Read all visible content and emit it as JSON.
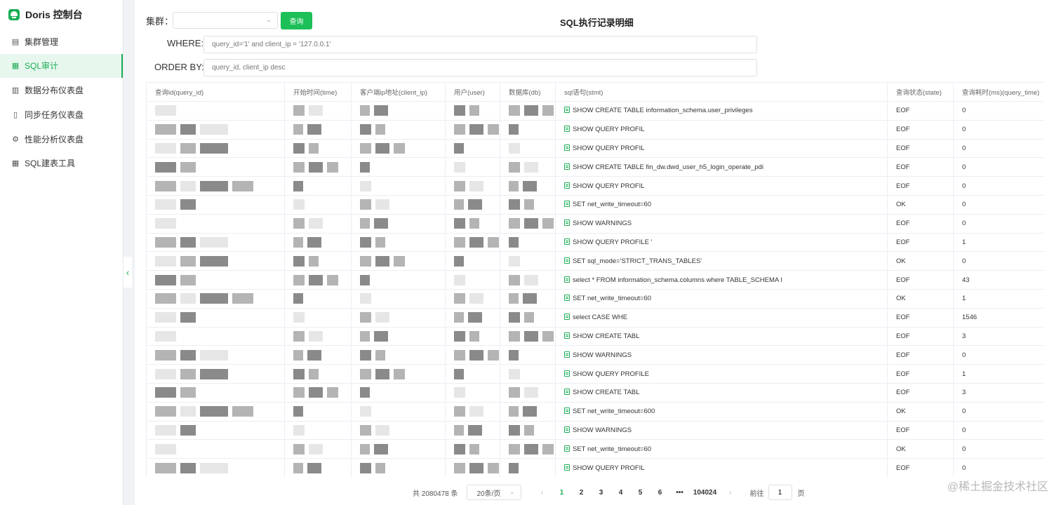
{
  "sidebar": {
    "brand": "Doris 控制台",
    "items": [
      {
        "label": "集群管理",
        "icon": "cluster-icon",
        "active": false
      },
      {
        "label": "SQL审计",
        "icon": "grid-icon",
        "active": true
      },
      {
        "label": "数据分布仪表盘",
        "icon": "bar-chart-icon",
        "active": false
      },
      {
        "label": "同步任务仪表盘",
        "icon": "document-icon",
        "active": false
      },
      {
        "label": "性能分析仪表盘",
        "icon": "gear-icon",
        "active": false
      },
      {
        "label": "SQL建表工具",
        "icon": "grid-icon",
        "active": false
      }
    ]
  },
  "toolbar": {
    "cluster_label": "集群：",
    "cluster_value": "",
    "query_button": "查询",
    "page_title": "SQL执行记录明细",
    "where_label": "WHERE:",
    "where_placeholder": "query_id='1' and client_ip = '127.0.0.1'",
    "order_label": "ORDER BY:",
    "order_placeholder": "query_id, client_ip desc"
  },
  "table": {
    "columns": [
      "查询id(query_id)",
      "开始时间(time)",
      "客户端ip地址(client_ip)",
      "用户(user)",
      "数据库(db)",
      "sql语句(stmt)",
      "查询状态(state)",
      "查询耗时(ms)(query_time)"
    ],
    "rows": [
      {
        "stmt": "SHOW CREATE TABLE information_schema.user_privileges",
        "state": "EOF",
        "time_ms": "0"
      },
      {
        "stmt": "SHOW QUERY PROFIL",
        "state": "EOF",
        "time_ms": "0"
      },
      {
        "stmt": "SHOW QUERY PROFIL",
        "state": "EOF",
        "time_ms": "0"
      },
      {
        "stmt": "SHOW CREATE TABLE fin_dw.dwd_user_h5_login_operate_pdi",
        "state": "EOF",
        "time_ms": "0"
      },
      {
        "stmt": "SHOW QUERY PROFIL",
        "state": "EOF",
        "time_ms": "0"
      },
      {
        "stmt": "SET net_write_timeout=60",
        "state": "OK",
        "time_ms": "0"
      },
      {
        "stmt": "SHOW WARNINGS",
        "state": "EOF",
        "time_ms": "0"
      },
      {
        "stmt": "SHOW QUERY PROFILE '",
        "state": "EOF",
        "time_ms": "1"
      },
      {
        "stmt": "SET sql_mode='STRICT_TRANS_TABLES'",
        "state": "OK",
        "time_ms": "0"
      },
      {
        "stmt": "select * FROM information_schema.columns where TABLE_SCHEMA I",
        "state": "EOF",
        "time_ms": "43"
      },
      {
        "stmt": "SET net_write_timeout=60",
        "state": "OK",
        "time_ms": "1"
      },
      {
        "stmt": "select CASE WHE",
        "state": "EOF",
        "time_ms": "1546"
      },
      {
        "stmt": "SHOW CREATE TABL",
        "state": "EOF",
        "time_ms": "3"
      },
      {
        "stmt": "SHOW WARNINGS",
        "state": "EOF",
        "time_ms": "0"
      },
      {
        "stmt": "SHOW QUERY PROFILE",
        "state": "EOF",
        "time_ms": "1"
      },
      {
        "stmt": "SHOW CREATE TABL",
        "state": "EOF",
        "time_ms": "3"
      },
      {
        "stmt": "SET net_write_timeout=600",
        "state": "OK",
        "time_ms": "0"
      },
      {
        "stmt": "SHOW WARNINGS",
        "state": "EOF",
        "time_ms": "0"
      },
      {
        "stmt": "SET net_write_timeout=60",
        "state": "OK",
        "time_ms": "0"
      },
      {
        "stmt": "SHOW QUERY PROFIL",
        "state": "EOF",
        "time_ms": "0"
      }
    ]
  },
  "pagination": {
    "total": "共 2080478 条",
    "page_size": "20条/页",
    "pages": [
      "1",
      "2",
      "3",
      "4",
      "5",
      "6"
    ],
    "ellipsis": "•••",
    "last_page": "104024",
    "goto_label": "前往",
    "goto_value": "1",
    "goto_suffix": "页"
  },
  "watermark": "@稀土掘金技术社区",
  "colors": {
    "accent": "#1aad55",
    "button": "#1cbf58"
  }
}
